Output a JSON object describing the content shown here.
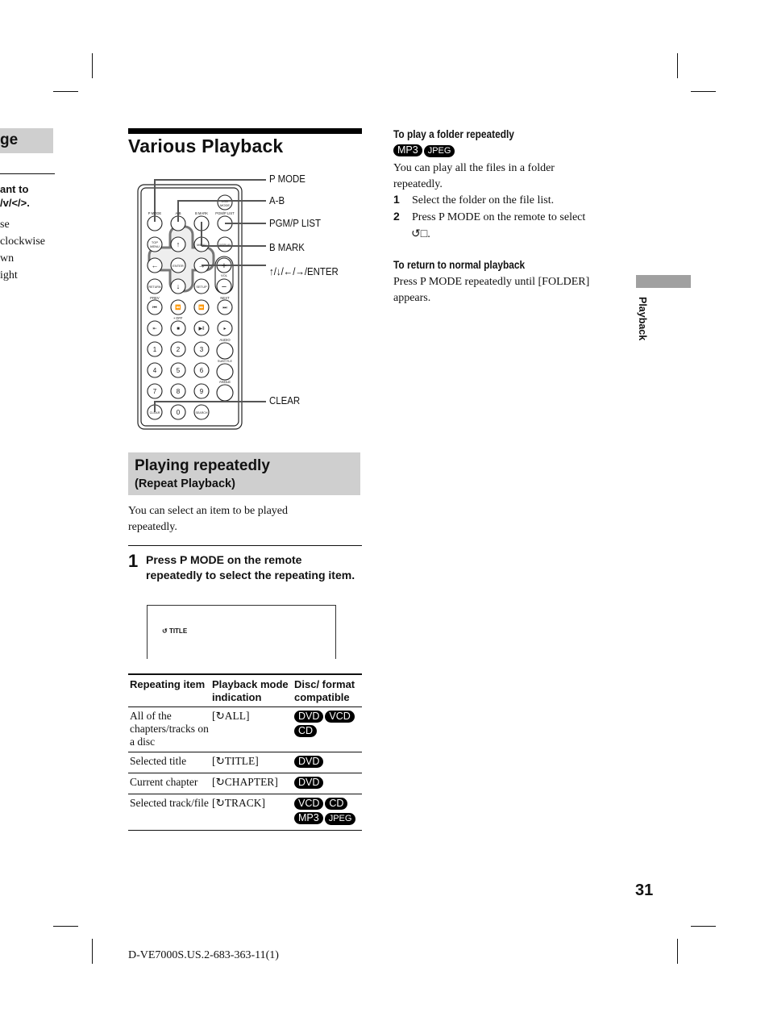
{
  "left_page_fragment": {
    "heading": "ge",
    "bold_lines": [
      "ant to",
      "/v/</>."
    ],
    "body_lines": [
      "se",
      "clockwise",
      "wn",
      "ight"
    ]
  },
  "title": "Various Playback",
  "remote_diagram": {
    "callouts": [
      "P MODE",
      "A-B",
      "PGM/P LIST",
      "B MARK",
      "↑/↓/←/→/ENTER",
      "CLEAR"
    ],
    "button_labels": {
      "lcd_mode": "LCD MODE",
      "p_mode": "P MODE",
      "ab": "A-B",
      "b_mark": "B MARK",
      "pgm": "PGM/P LIST",
      "top_menu": "TOP MENU",
      "menu": "MENU",
      "display": "DISPLAY",
      "enter": "ENTER",
      "vol": "VOL",
      "return": "RETURN",
      "setup": "SETUP",
      "prev": "PREV",
      "next": "NEXT",
      "off": "• OFF",
      "audio": "AUDIO",
      "subtitle": "SUBTITLE",
      "angle": "ANGLE",
      "clear": "CLEAR",
      "search": "SEARCH",
      "digits": [
        "1",
        "2",
        "3",
        "4",
        "5",
        "6",
        "7",
        "8",
        "9",
        "0"
      ]
    }
  },
  "section": {
    "heading": "Playing repeatedly",
    "subheading": "(Repeat Playback)",
    "intro": "You can select an item to be played repeatedly.",
    "step_number": "1",
    "step_text": "Press P MODE on the remote repeatedly to select the repeating item.",
    "screen_indicator": "TITLE"
  },
  "table": {
    "headers": [
      "Repeating item",
      "Playback mode indication",
      "Disc/ format compatible"
    ],
    "rows": [
      {
        "item": "All of the chapters/tracks on a disc",
        "indication": "[↻ALL]",
        "formats": [
          "DVD",
          "VCD",
          "CD"
        ]
      },
      {
        "item": "Selected title",
        "indication": "[↻TITLE]",
        "formats": [
          "DVD"
        ]
      },
      {
        "item": "Current chapter",
        "indication": "[↻CHAPTER]",
        "formats": [
          "DVD"
        ]
      },
      {
        "item": "Selected track/file",
        "indication": "[↻TRACK]",
        "formats": [
          "VCD",
          "CD",
          "MP3",
          "JPEG"
        ]
      }
    ]
  },
  "folder_repeat": {
    "heading": "To play a folder repeatedly",
    "formats": [
      "MP3",
      "JPEG"
    ],
    "intro": "You can play all the files in a folder repeatedly.",
    "steps": [
      {
        "num": "1",
        "text": "Select the folder on the file list."
      },
      {
        "num": "2",
        "text": "Press P MODE on the remote to select"
      }
    ]
  },
  "return_normal": {
    "heading": "To return to normal playback",
    "text": "Press P MODE repeatedly until [FOLDER] appears."
  },
  "side_tab": "Playback",
  "page_number": "31",
  "footer": "D-VE7000S.US.2-683-363-11(1)"
}
